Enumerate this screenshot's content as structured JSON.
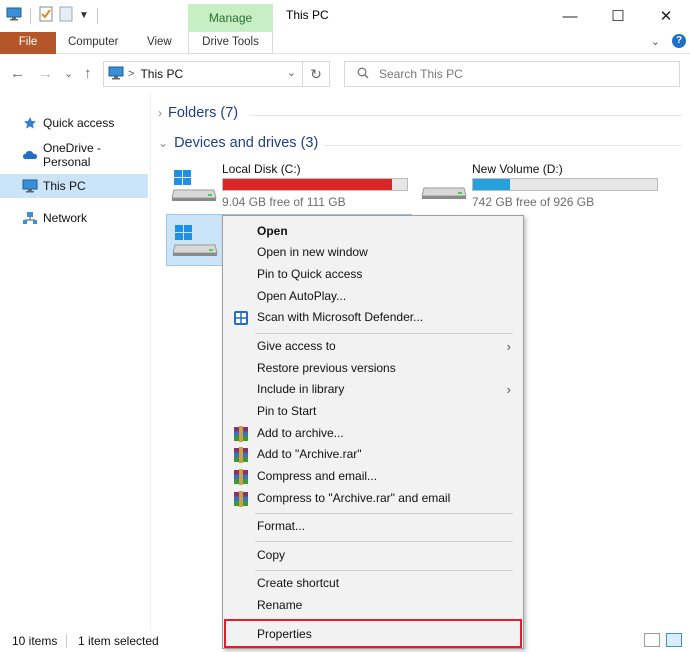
{
  "window": {
    "title": "This PC",
    "contextual_tab": "Manage",
    "minimize": "—",
    "maximize": "☐",
    "close": "✕"
  },
  "ribbon": {
    "tabs": [
      "File",
      "Computer",
      "View",
      "Drive Tools"
    ],
    "file_color": "#b5562a",
    "manage_color": "#c6efc6"
  },
  "navigation": {
    "back": "←",
    "forward": "→",
    "recent": "⌄",
    "up": "↑",
    "address": "This PC",
    "address_sep": ">",
    "refresh": "↻",
    "search_placeholder": "Search This PC"
  },
  "sidebar": {
    "items": [
      {
        "label": "Quick access",
        "icon": "star-icon"
      },
      {
        "label": "OneDrive - Personal",
        "icon": "cloud-icon"
      },
      {
        "label": "This PC",
        "icon": "computer-icon",
        "selected": true
      },
      {
        "label": "Network",
        "icon": "network-icon"
      }
    ]
  },
  "content": {
    "folders_header": "Folders (7)",
    "devices_header": "Devices and drives (3)",
    "drives": [
      {
        "name": "Local Disk (C:)",
        "free": "9.04 GB free of 111 GB",
        "used_fraction": 0.919,
        "bar_color": "#da2626"
      },
      {
        "name": "New Volume (D:)",
        "free": "742 GB free of 926 GB",
        "used_fraction": 0.199,
        "bar_color": "#26a0da"
      }
    ]
  },
  "context_menu": {
    "items": [
      {
        "label": "Open",
        "bold": true
      },
      {
        "label": "Open in new window"
      },
      {
        "label": "Pin to Quick access"
      },
      {
        "label": "Open AutoPlay..."
      },
      {
        "label": "Scan with Microsoft Defender...",
        "icon": "defender-icon"
      },
      {
        "label": "Give access to",
        "submenu": true
      },
      {
        "label": "Restore previous versions"
      },
      {
        "label": "Include in library",
        "submenu": true
      },
      {
        "label": "Pin to Start"
      },
      {
        "label": "Add to archive...",
        "icon": "winrar-icon"
      },
      {
        "label": "Add to \"Archive.rar\"",
        "icon": "winrar-icon"
      },
      {
        "label": "Compress and email...",
        "icon": "winrar-icon"
      },
      {
        "label": "Compress to \"Archive.rar\" and email",
        "icon": "winrar-icon"
      },
      {
        "label": "Format..."
      },
      {
        "label": "Copy"
      },
      {
        "label": "Create shortcut"
      },
      {
        "label": "Rename"
      },
      {
        "label": "Properties",
        "highlighted": true
      }
    ]
  },
  "status": {
    "items": "10 items",
    "selected": "1 item selected"
  }
}
